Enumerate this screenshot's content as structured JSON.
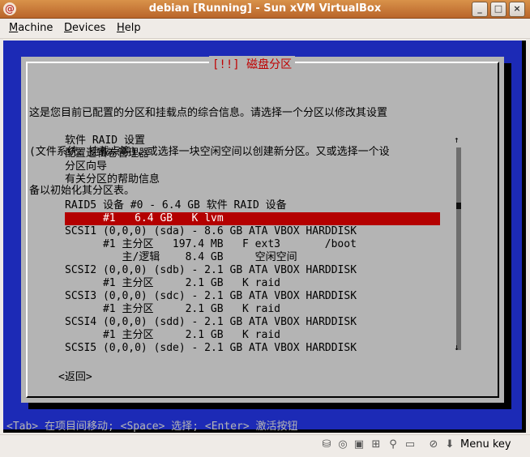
{
  "window": {
    "title": "debian [Running] - Sun xVM VirtualBox"
  },
  "menubar": {
    "items": [
      {
        "mnemonic": "M",
        "rest": "achine"
      },
      {
        "mnemonic": "D",
        "rest": "evices"
      },
      {
        "mnemonic": "H",
        "rest": "elp"
      }
    ]
  },
  "installer": {
    "dialog_title": "[!!] 磁盘分区",
    "description": [
      "这是您目前已配置的分区和挂载点的综合信息。请选择一个分区以修改其设置",
      "(文件系统、挂载点等)，或选择一块空闲空间以创建新分区。又或选择一个设",
      "备以初始化其分区表。"
    ],
    "list": [
      "软件 RAID 设置",
      "配置逻辑卷管理器",
      "分区向导",
      "有关分区的帮助信息",
      "",
      "RAID5 设备 #0 - 6.4 GB 软件 RAID 设备",
      "      #1   6.4 GB   K lvm",
      "SCSI1 (0,0,0) (sda) - 8.6 GB ATA VBOX HARDDISK",
      "      #1 主分区   197.4 MB   F ext3       /boot",
      "         主/逻辑    8.4 GB     空闲空间",
      "SCSI2 (0,0,0) (sdb) - 2.1 GB ATA VBOX HARDDISK",
      "      #1 主分区     2.1 GB   K raid",
      "SCSI3 (0,0,0) (sdc) - 2.1 GB ATA VBOX HARDDISK",
      "      #1 主分区     2.1 GB   K raid",
      "SCSI4 (0,0,0) (sdd) - 2.1 GB ATA VBOX HARDDISK",
      "      #1 主分区     2.1 GB   K raid",
      "SCSI5 (0,0,0) (sde) - 2.1 GB ATA VBOX HARDDISK"
    ],
    "selected_index": 6,
    "back_button": "<返回>",
    "scroll_up": "↑",
    "scroll_down": "↓",
    "help_line": "<Tab> 在项目间移动; <Space> 选择; <Enter> 激活按钮"
  },
  "statusbar": {
    "icons": [
      "harddisk-icon",
      "cdrom-icon",
      "floppy-icon",
      "network-icon",
      "usb-icon",
      "shared-folder-icon",
      "mouse-integration-icon",
      "capture-icon"
    ],
    "host_key_label": "Menu key"
  },
  "colors": {
    "titlebar": "#c97a3a",
    "vm_background": "#1c2ab6",
    "dialog": "#b4b4b4",
    "selection": "#b40000",
    "dialog_title": "#c00000"
  }
}
